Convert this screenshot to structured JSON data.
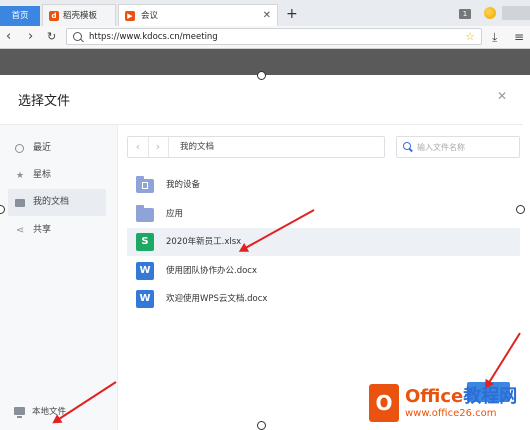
{
  "browser": {
    "tabs": [
      {
        "label": "首页",
        "icon": "home"
      },
      {
        "label": "稻壳模板",
        "icon": "docer-icon"
      },
      {
        "label": "会议",
        "icon": "meeting-icon"
      }
    ],
    "tab_count": "1",
    "url": "https://www.kdocs.cn/meeting"
  },
  "dialog": {
    "title": "选择文件",
    "sidebar": {
      "items": [
        {
          "label": "最近",
          "icon": "clock-icon"
        },
        {
          "label": "星标",
          "icon": "star-icon"
        },
        {
          "label": "我的文档",
          "icon": "folder-icon",
          "active": true
        },
        {
          "label": "共享",
          "icon": "share-icon"
        }
      ],
      "local_file": "本地文件"
    },
    "path": {
      "current": "我的文档"
    },
    "search": {
      "placeholder": "输入文件名称"
    },
    "files": [
      {
        "name": "我的设备",
        "type": "device-folder"
      },
      {
        "name": "应用",
        "type": "folder"
      },
      {
        "name": "2020年新员工.xlsx",
        "type": "sheet",
        "icon_letter": "S",
        "selected": true
      },
      {
        "name": "使用团队协作办公.docx",
        "type": "doc",
        "icon_letter": "W"
      },
      {
        "name": "欢迎使用WPS云文档.docx",
        "type": "doc",
        "icon_letter": "W"
      }
    ]
  },
  "watermark": {
    "logo_letter": "O",
    "brand_part1": "Office",
    "brand_part2": "教程网",
    "url": "www.office26.com"
  },
  "colors": {
    "accent": "#3a86e0",
    "annotation_arrow": "#e02222",
    "sheet": "#1ea866",
    "doc": "#3479d8",
    "brand": "#e9530f"
  }
}
